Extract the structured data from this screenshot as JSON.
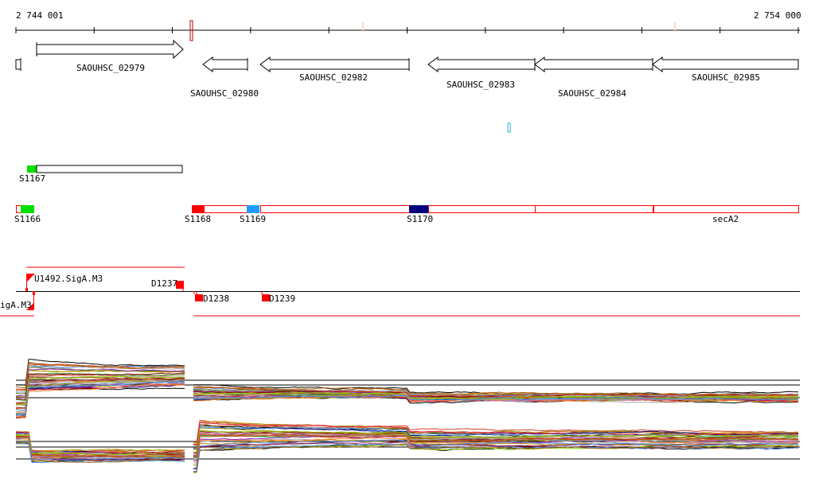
{
  "ruler": {
    "start_label": "2 744 001",
    "end_label": "2 754 000"
  },
  "genes": [
    {
      "id": "SAOUHSC_02979",
      "strand": "+"
    },
    {
      "id": "SAOUHSC_02980",
      "strand": "-"
    },
    {
      "id": "SAOUHSC_02982",
      "strand": "-"
    },
    {
      "id": "SAOUHSC_02983",
      "strand": "-"
    },
    {
      "id": "SAOUHSC_02984",
      "strand": "-"
    },
    {
      "id": "SAOUHSC_02985",
      "strand": "-"
    }
  ],
  "segments": [
    "S1167",
    "S1166",
    "S1168",
    "S1169",
    "S1170",
    "secA2"
  ],
  "features": {
    "upstream_fwd": "U1492.SigA.M3",
    "upstream_rev": "igA.M3",
    "downstream": [
      "D1237",
      "D1238",
      "D1239"
    ]
  },
  "colors": {
    "red": "#ff0000",
    "green": "#00e000",
    "blue": "#1e9bff",
    "navy": "#000080"
  }
}
